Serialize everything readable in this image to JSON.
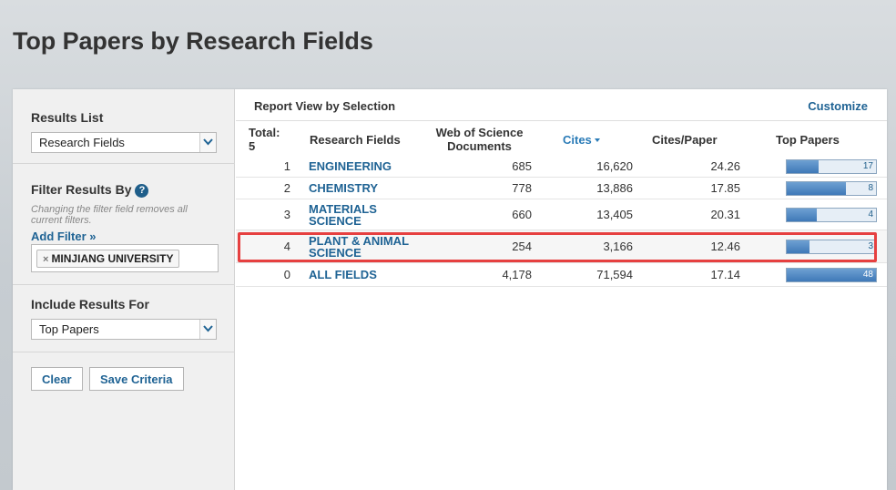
{
  "page": {
    "title": "Top Papers by Research Fields"
  },
  "sidebar": {
    "results_list": {
      "label": "Results List",
      "selected": "Research Fields"
    },
    "filter": {
      "label": "Filter Results By",
      "help_icon": "?",
      "hint": "Changing the filter field removes all current filters.",
      "add_filter": "Add Filter »",
      "chips": [
        "MINJIANG UNIVERSITY"
      ],
      "chip_remove": "×"
    },
    "include": {
      "label": "Include Results For",
      "selected": "Top Papers"
    },
    "buttons": {
      "clear": "Clear",
      "save": "Save Criteria"
    }
  },
  "report": {
    "title": "Report View by Selection",
    "customize": "Customize",
    "columns": {
      "total_label": "Total:",
      "total_value": "5",
      "field": "Research Fields",
      "docs_line1": "Web of Science",
      "docs_line2": "Documents",
      "cites": "Cites",
      "cites_per_paper": "Cites/Paper",
      "top_papers": "Top Papers"
    },
    "rows": [
      {
        "rank": "1",
        "field": "ENGINEERING",
        "docs": "685",
        "cites": "16,620",
        "cpp": "24.26",
        "top": "17",
        "fill": 0.354
      },
      {
        "rank": "2",
        "field": "CHEMISTRY",
        "docs": "778",
        "cites": "13,886",
        "cpp": "17.85",
        "top": "8",
        "fill": 0.667
      },
      {
        "rank": "3",
        "field": "MATERIALS SCIENCE",
        "docs": "660",
        "cites": "13,405",
        "cpp": "20.31",
        "top": "4",
        "fill": 0.333
      },
      {
        "rank": "4",
        "field": "PLANT & ANIMAL SCIENCE",
        "docs": "254",
        "cites": "3,166",
        "cpp": "12.46",
        "top": "3",
        "fill": 0.25
      },
      {
        "rank": "0",
        "field": "ALL FIELDS",
        "docs": "4,178",
        "cites": "71,594",
        "cpp": "17.14",
        "top": "48",
        "fill": 1.0
      }
    ]
  },
  "colors": {
    "link": "#1f6394",
    "highlight": "#e64040",
    "bar": "#4a84c0"
  }
}
